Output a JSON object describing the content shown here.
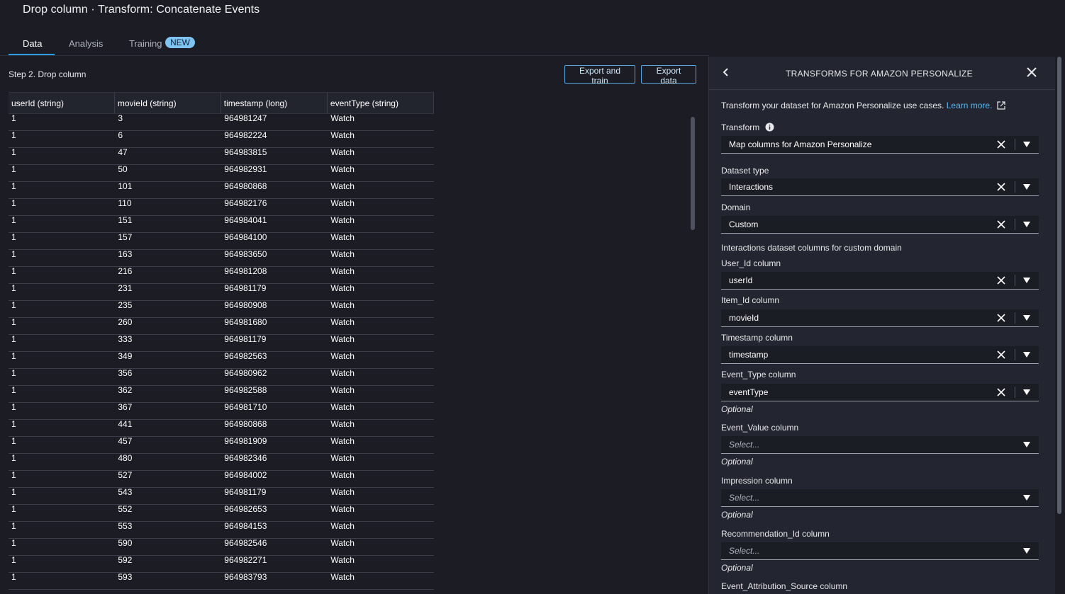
{
  "header": {
    "title": "Drop column · Transform: Concatenate Events"
  },
  "tabs": [
    {
      "label": "Data",
      "active": true
    },
    {
      "label": "Analysis",
      "active": false
    },
    {
      "label": "Training",
      "active": false,
      "badge": "NEW"
    }
  ],
  "toolbar": {
    "step_label": "Step 2. Drop column",
    "export_train_label": "Export and train",
    "export_data_label": "Export data"
  },
  "table": {
    "columns": [
      "userId (string)",
      "movieId (string)",
      "timestamp (long)",
      "eventType (string)"
    ],
    "rows": [
      [
        "1",
        "3",
        "964981247",
        "Watch"
      ],
      [
        "1",
        "6",
        "964982224",
        "Watch"
      ],
      [
        "1",
        "47",
        "964983815",
        "Watch"
      ],
      [
        "1",
        "50",
        "964982931",
        "Watch"
      ],
      [
        "1",
        "101",
        "964980868",
        "Watch"
      ],
      [
        "1",
        "110",
        "964982176",
        "Watch"
      ],
      [
        "1",
        "151",
        "964984041",
        "Watch"
      ],
      [
        "1",
        "157",
        "964984100",
        "Watch"
      ],
      [
        "1",
        "163",
        "964983650",
        "Watch"
      ],
      [
        "1",
        "216",
        "964981208",
        "Watch"
      ],
      [
        "1",
        "231",
        "964981179",
        "Watch"
      ],
      [
        "1",
        "235",
        "964980908",
        "Watch"
      ],
      [
        "1",
        "260",
        "964981680",
        "Watch"
      ],
      [
        "1",
        "333",
        "964981179",
        "Watch"
      ],
      [
        "1",
        "349",
        "964982563",
        "Watch"
      ],
      [
        "1",
        "356",
        "964980962",
        "Watch"
      ],
      [
        "1",
        "362",
        "964982588",
        "Watch"
      ],
      [
        "1",
        "367",
        "964981710",
        "Watch"
      ],
      [
        "1",
        "441",
        "964980868",
        "Watch"
      ],
      [
        "1",
        "457",
        "964981909",
        "Watch"
      ],
      [
        "1",
        "480",
        "964982346",
        "Watch"
      ],
      [
        "1",
        "527",
        "964984002",
        "Watch"
      ],
      [
        "1",
        "543",
        "964981179",
        "Watch"
      ],
      [
        "1",
        "552",
        "964982653",
        "Watch"
      ],
      [
        "1",
        "553",
        "964984153",
        "Watch"
      ],
      [
        "1",
        "590",
        "964982546",
        "Watch"
      ],
      [
        "1",
        "592",
        "964982271",
        "Watch"
      ],
      [
        "1",
        "593",
        "964983793",
        "Watch"
      ]
    ]
  },
  "panel": {
    "title": "TRANSFORMS FOR AMAZON PERSONALIZE",
    "description": "Transform your dataset for Amazon Personalize use cases.",
    "learn_more": "Learn more.",
    "transform_label": "Transform",
    "transform_value": "Map columns for Amazon Personalize",
    "dataset_type_label": "Dataset type",
    "dataset_type_value": "Interactions",
    "domain_label": "Domain",
    "domain_value": "Custom",
    "section_label": "Interactions dataset columns for custom domain",
    "user_id_label": "User_Id column",
    "user_id_value": "userId",
    "item_id_label": "Item_Id column",
    "item_id_value": "movieId",
    "timestamp_label": "Timestamp column",
    "timestamp_value": "timestamp",
    "event_type_label": "Event_Type column",
    "event_type_value": "eventType",
    "optional_text": "Optional",
    "event_value_label": "Event_Value column",
    "impression_label": "Impression column",
    "recommendation_label": "Recommendation_Id column",
    "attribution_label": "Event_Attribution_Source column",
    "select_placeholder": "Select..."
  },
  "icons": {
    "back": "chevron-left-icon",
    "close": "close-icon",
    "info": "info-icon",
    "external": "external-link-icon",
    "clear": "clear-x-icon",
    "caret": "caret-down-icon"
  },
  "colors": {
    "accent": "#2e9be3",
    "link": "#5fb8ef",
    "badge": "#7fc4f0"
  }
}
